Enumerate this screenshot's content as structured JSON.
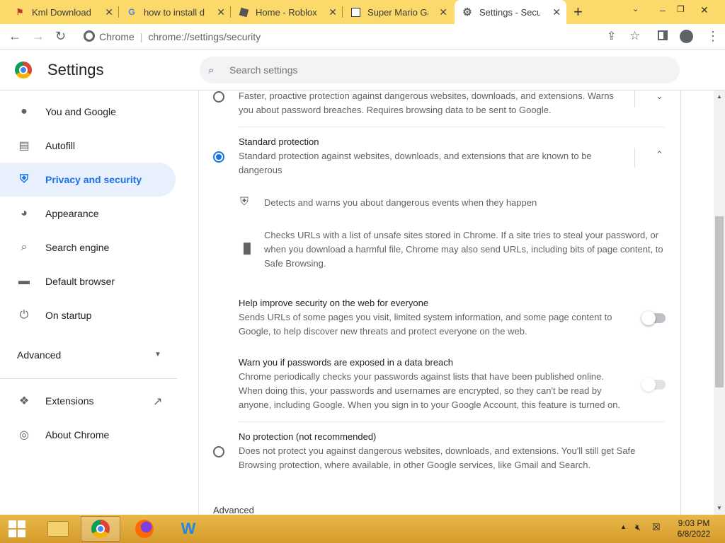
{
  "browser": {
    "tabs": [
      {
        "title": "Kml Download - I",
        "favicon": "kml-icon"
      },
      {
        "title": "how to install do",
        "favicon": "google-g-icon"
      },
      {
        "title": "Home - Roblox",
        "favicon": "roblox-icon"
      },
      {
        "title": "Super Mario Gala",
        "favicon": "mario-icon"
      },
      {
        "title": "Settings - Securit",
        "favicon": "gear-icon",
        "active": true
      }
    ],
    "omnibox": {
      "scheme_label": "Chrome",
      "url": "chrome://settings/security"
    }
  },
  "settings": {
    "title": "Settings",
    "search_placeholder": "Search settings"
  },
  "sidebar": {
    "items": [
      {
        "label": "You and Google",
        "icon": "person-icon"
      },
      {
        "label": "Autofill",
        "icon": "clipboard-icon"
      },
      {
        "label": "Privacy and security",
        "icon": "shield-icon",
        "selected": true
      },
      {
        "label": "Appearance",
        "icon": "palette-icon"
      },
      {
        "label": "Search engine",
        "icon": "search-icon"
      },
      {
        "label": "Default browser",
        "icon": "browser-icon"
      },
      {
        "label": "On startup",
        "icon": "power-icon"
      }
    ],
    "advanced_label": "Advanced",
    "extensions_label": "Extensions",
    "about_label": "About Chrome"
  },
  "main": {
    "enhanced": {
      "desc_line1": "Faster, proactive protection against dangerous websites, downloads, and extensions. Warns",
      "desc_line2": "you about password breaches. Requires browsing data to be sent to Google."
    },
    "standard": {
      "title": "Standard protection",
      "desc_line1": "Standard protection against websites, downloads, and extensions that are known to be",
      "desc_line2": "dangerous",
      "detail1": "Detects and warns you about dangerous events when they happen",
      "detail2_line1": "Checks URLs with a list of unsafe sites stored in Chrome. If a site tries to steal your password, or",
      "detail2_line2": "when you download a harmful file, Chrome may also send URLs, including bits of page content, to",
      "detail2_line3": "Safe Browsing."
    },
    "help_improve": {
      "title": "Help improve security on the web for everyone",
      "desc_line1": "Sends URLs of some pages you visit, limited system information, and some page content to",
      "desc_line2": "Google, to help discover new threats and protect everyone on the web."
    },
    "password_warn": {
      "title": "Warn you if passwords are exposed in a data breach",
      "desc_line1": "Chrome periodically checks your passwords against lists that have been published online.",
      "desc_line2": "When doing this, your passwords and usernames are encrypted, so they can't be read by",
      "desc_line3": "anyone, including Google. When you sign in to your Google Account, this feature is turned on."
    },
    "no_protection": {
      "title": "No protection (not recommended)",
      "desc_line1": "Does not protect you against dangerous websites, downloads, and extensions. You'll still get Safe",
      "desc_line2": "Browsing protection, where available, in other Google services, like Gmail and Search."
    },
    "advanced_label": "Advanced"
  },
  "taskbar": {
    "time": "9:03 PM",
    "date": "6/8/2022"
  },
  "colors": {
    "accent": "#1a73e8",
    "selected_bg": "#e8f0fe",
    "tabstrip": "#fbd96a",
    "taskbar": "#d9a437"
  }
}
